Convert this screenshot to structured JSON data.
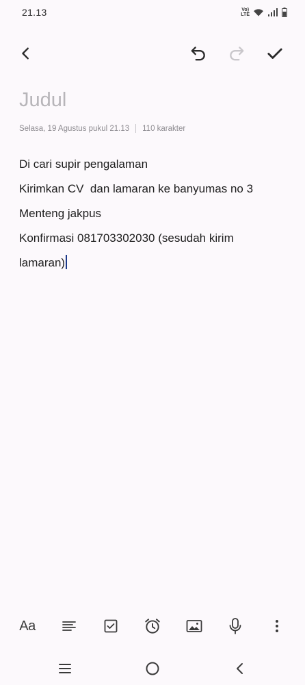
{
  "status_bar": {
    "time": "21.13",
    "volte_label": "Vo) LTE"
  },
  "toolbar": {
    "back_icon": "chevron-left-icon",
    "undo_icon": "undo-icon",
    "redo_icon": "redo-icon",
    "save_icon": "check-icon"
  },
  "note": {
    "title_placeholder": "Judul",
    "date": "Selasa, 19 Agustus pukul 21.13",
    "char_count": "110 karakter",
    "lines": [
      "Di cari supir pengalaman",
      "Kirimkan CV  dan lamaran ke banyumas no 3",
      "Menteng jakpus",
      "Konfirmasi 081703302030 (sesudah kirim",
      "lamaran)"
    ]
  },
  "bottom_toolbar": {
    "text_style_label": "Aa",
    "items": [
      "text-style-icon",
      "align-icon",
      "checkbox-icon",
      "alarm-icon",
      "image-icon",
      "microphone-icon",
      "more-vertical-icon"
    ]
  },
  "nav_bar": {
    "items": [
      "recent-apps-icon",
      "home-icon",
      "back-icon"
    ]
  },
  "colors": {
    "background": "#fcf9fc",
    "cursor": "#1c3a8a",
    "placeholder": "#b7b5b9"
  }
}
